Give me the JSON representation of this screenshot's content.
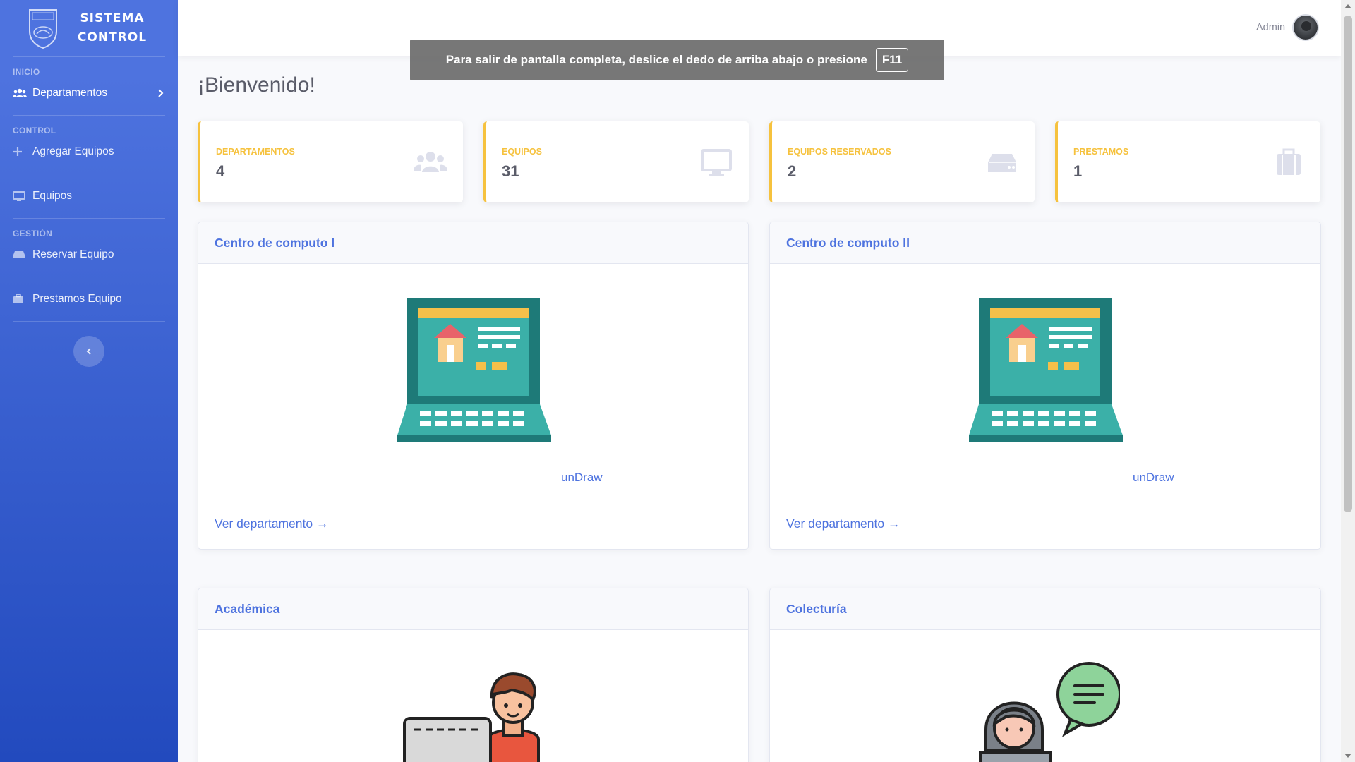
{
  "brand": {
    "line1": "SISTEMA",
    "line2": "CONTROL",
    "logo_icon": "university-crest-icon"
  },
  "sidebar": {
    "sections": [
      {
        "heading": "INICIO"
      },
      {
        "heading": "CONTROL"
      },
      {
        "heading": "GESTIÓN"
      }
    ],
    "items": [
      {
        "label": "Departamentos",
        "icon": "users-icon",
        "has_chevron": true
      },
      {
        "label": "Agregar Equipos",
        "icon": "plus-icon"
      },
      {
        "label": "Equipos",
        "icon": "desktop-icon"
      },
      {
        "label": "Reservar Equipo",
        "icon": "hdd-icon"
      },
      {
        "label": "Prestamos Equipo",
        "icon": "briefcase-icon"
      }
    ]
  },
  "topbar": {
    "user_name": "Admin"
  },
  "toast": {
    "text": "Para salir de pantalla completa, deslice el dedo de arriba abajo o presione",
    "key": "F11"
  },
  "page": {
    "title": "¡Bienvenido!"
  },
  "stats": [
    {
      "label": "DEPARTAMENTOS",
      "value": "4",
      "icon": "users-icon"
    },
    {
      "label": "EQUIPOS",
      "value": "31",
      "icon": "desktop-icon"
    },
    {
      "label": "EQUIPOS RESERVADOS",
      "value": "2",
      "icon": "hdd-icon"
    },
    {
      "label": "PRESTAMOS",
      "value": "1",
      "icon": "briefcase-icon"
    }
  ],
  "cards": [
    {
      "title": "Centro de computo I",
      "credit": "unDraw",
      "link": "Ver departamento →"
    },
    {
      "title": "Centro de computo II",
      "credit": "unDraw",
      "link": "Ver departamento →"
    },
    {
      "title": "Académica"
    },
    {
      "title": "Colecturía"
    }
  ],
  "colors": {
    "primary": "#4e73df",
    "warning": "#f6c23e",
    "sidebar_dark": "#224abe"
  }
}
